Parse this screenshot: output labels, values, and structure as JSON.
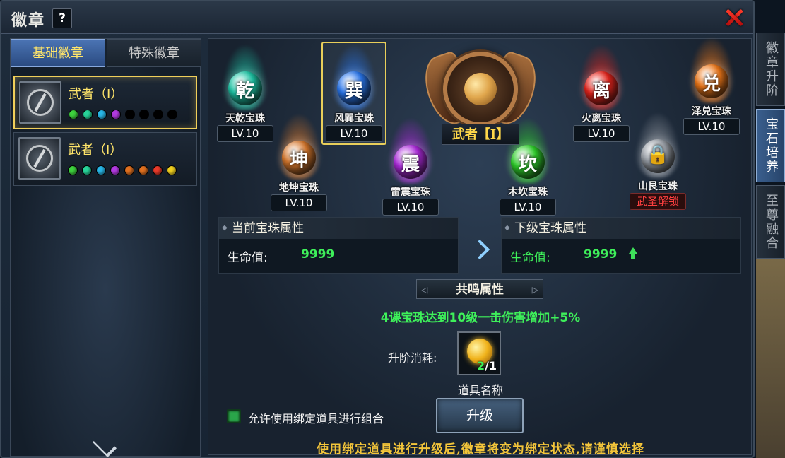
{
  "window": {
    "title": "徽章",
    "help": "?"
  },
  "tabs": [
    {
      "label": "基础徽章",
      "active": true
    },
    {
      "label": "特殊徽章",
      "active": false
    }
  ],
  "badges": [
    {
      "name": "武者（I）",
      "dots": [
        "#3ed23e",
        "#28d49a",
        "#28b6e6",
        "#b23ae0",
        "#000000",
        "#000000",
        "#000000",
        "#000000"
      ]
    },
    {
      "name": "武者（I）",
      "dots": [
        "#3ed23e",
        "#28d49a",
        "#28b6e6",
        "#b23ae0",
        "#e07020",
        "#e07020",
        "#e83a2a",
        "#f0d020"
      ]
    }
  ],
  "gems": [
    {
      "glyph": "乾",
      "name": "天乾宝珠",
      "level": "LV.10",
      "color": "#1ec8a8",
      "locked": false,
      "selected": false
    },
    {
      "glyph": "巽",
      "name": "风巽宝珠",
      "level": "LV.10",
      "color": "#2a78f0",
      "locked": false,
      "selected": true
    },
    {
      "glyph": "离",
      "name": "火离宝珠",
      "level": "LV.10",
      "color": "#e8241c",
      "locked": false,
      "selected": false
    },
    {
      "glyph": "兑",
      "name": "泽兑宝珠",
      "level": "LV.10",
      "color": "#f07818",
      "locked": false,
      "selected": false
    },
    {
      "glyph": "坤",
      "name": "地坤宝珠",
      "level": "LV.10",
      "color": "#d8782c",
      "locked": false,
      "selected": false
    },
    {
      "glyph": "震",
      "name": "雷震宝珠",
      "level": "LV.10",
      "color": "#b02ae0",
      "locked": false,
      "selected": false
    },
    {
      "glyph": "坎",
      "name": "木坎宝珠",
      "level": "LV.10",
      "color": "#2ed22a",
      "locked": false,
      "selected": false
    },
    {
      "glyph": "",
      "name": "山艮宝珠",
      "level": "武圣解锁",
      "color": "#9aa0a8",
      "locked": true,
      "selected": false
    }
  ],
  "emblem": {
    "name": "武者",
    "grade": "【I】"
  },
  "current_attr": {
    "title": "当前宝珠属性",
    "label": "生命值:",
    "value": "9999"
  },
  "next_attr": {
    "title": "下级宝珠属性",
    "label": "生命值:",
    "value": "9999"
  },
  "resonance": {
    "title": "共鸣属性",
    "text": "4课宝珠达到10级一击伤害增加+5%"
  },
  "cost": {
    "label": "升阶消耗:",
    "owned": "2",
    "required": "/1",
    "item_name": "道具名称"
  },
  "checkbox": {
    "label": "允许使用绑定道具进行组合",
    "checked": true
  },
  "upgrade_button": "升级",
  "warning": "使用绑定道具进行升级后,徽章将变为绑定状态,请谨慎选择",
  "side_tabs": [
    {
      "label": "徽章升阶",
      "active": false
    },
    {
      "label": "宝石培养",
      "active": true
    },
    {
      "label": "至尊融合",
      "active": false
    }
  ]
}
